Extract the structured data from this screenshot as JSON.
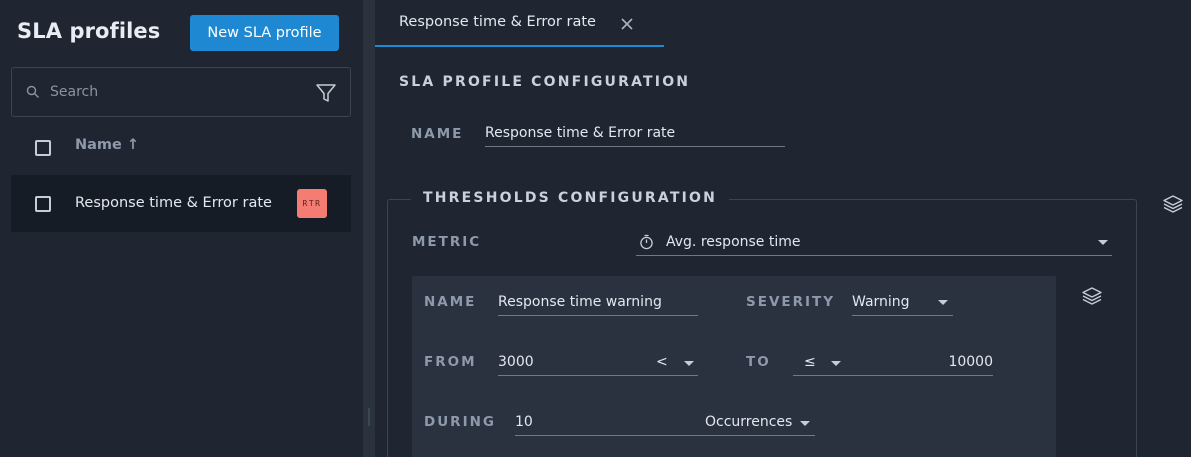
{
  "left": {
    "title": "SLA profiles",
    "new_button": "New SLA profile",
    "search_placeholder": "Search",
    "header_label": "Name ↑",
    "items": [
      {
        "label": "Response time & Error rate",
        "badge": "RTR"
      }
    ]
  },
  "tab": {
    "label": "Response time & Error rate"
  },
  "config": {
    "section_title": "SLA PROFILE CONFIGURATION",
    "name_label": "NAME",
    "name_value": "Response time & Error rate"
  },
  "thresholds": {
    "title": "THRESHOLDS CONFIGURATION",
    "metric_label": "METRIC",
    "metric_value": "Avg. response time",
    "name_label": "NAME",
    "name_value": "Response time warning",
    "severity_label": "SEVERITY",
    "severity_value": "Warning",
    "from_label": "FROM",
    "from_value": "3000",
    "from_operator": "<",
    "to_label": "TO",
    "to_operator": "≤",
    "to_value": "10000",
    "during_label": "DURING",
    "during_value": "10",
    "during_unit": "Occurrences"
  },
  "colors": {
    "accent": "#1e88d3",
    "badge": "#f47c72",
    "background": "#1f2631"
  }
}
